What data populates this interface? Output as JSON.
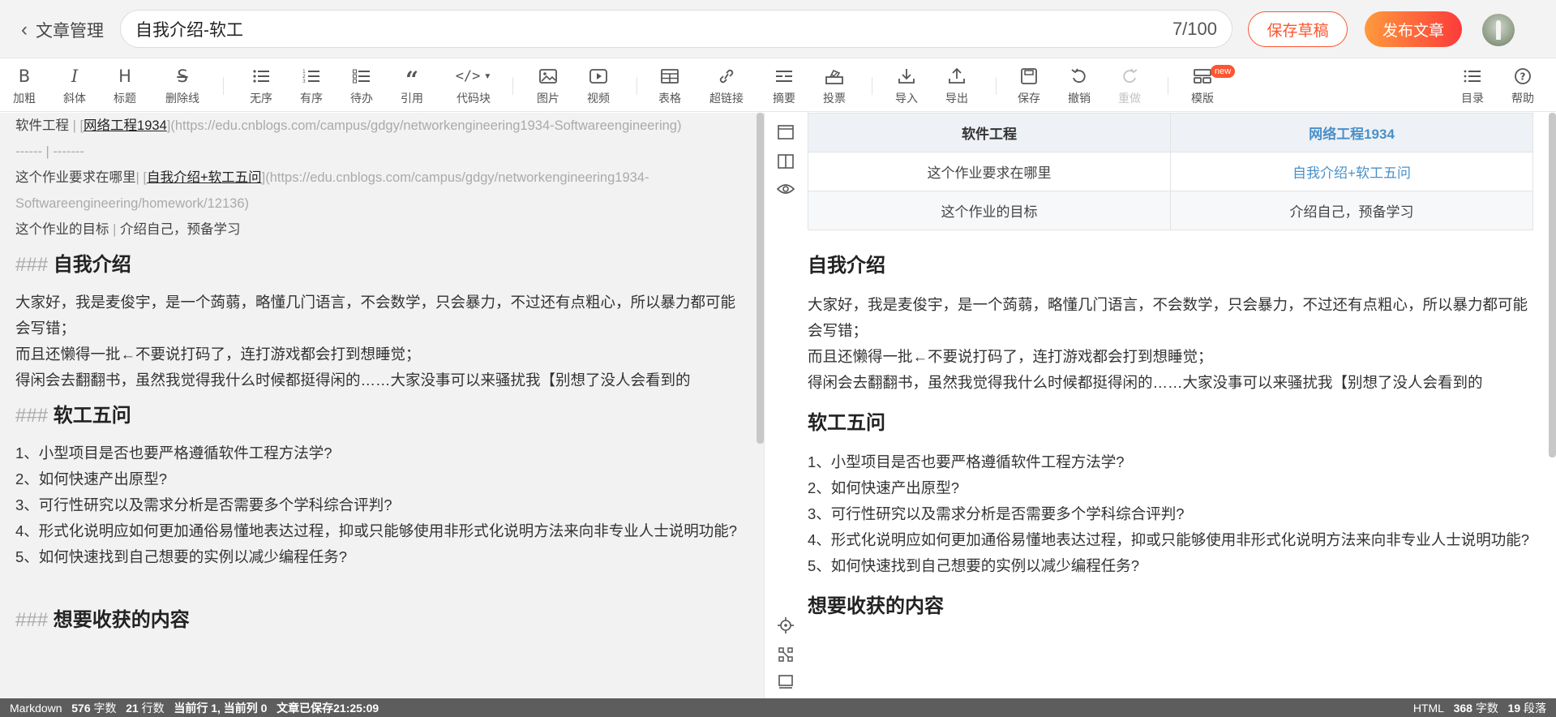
{
  "topbar": {
    "back_label": "文章管理",
    "title_value": "自我介绍-软工",
    "title_count": "7/100",
    "save_draft": "保存草稿",
    "publish": "发布文章"
  },
  "toolbar": {
    "bold": "加粗",
    "italic": "斜体",
    "heading": "标题",
    "strike": "删除线",
    "ul": "无序",
    "ol": "有序",
    "todo": "待办",
    "quote": "引用",
    "code": "代码块",
    "image": "图片",
    "video": "视频",
    "table": "表格",
    "link": "超链接",
    "summary": "摘要",
    "vote": "投票",
    "import": "导入",
    "export": "导出",
    "save": "保存",
    "undo": "撤销",
    "redo": "重做",
    "template": "模版",
    "template_badge": "new",
    "toc": "目录",
    "help": "帮助"
  },
  "editor": {
    "line1_course": "软件工程",
    "line1_sep": " | [",
    "line1_link": "网络工程1934",
    "line1_url": "](https://edu.cnblogs.com/campus/gdgy/networkengineering1934-Softwareengineering)",
    "line2": "------ | -------",
    "line3_label": "这个作业要求在哪里",
    "line3_sep": "| [",
    "line3_link": "自我介绍+软工五问",
    "line3_url_a": "](https://edu.cnblogs.com/campus/gdgy/networkengineering1934-",
    "line3_url_b": "Softwareengineering/homework/12136)",
    "line4_label": "这个作业的目标",
    "line4_sep": " | ",
    "line4_value": "介绍自己，预备学习",
    "h3_hash": "###",
    "h3_intro": "自我介绍",
    "intro_1": "大家好，我是麦俊宇，是一个蒟蒻，略懂几门语言，不会数学，只会暴力，不过还有点粗心，所以暴力都可能会写错；",
    "intro_2": "而且还懒得一批←不要说打码了，连打游戏都会打到想睡觉；",
    "intro_3": "得闲会去翻翻书，虽然我觉得我什么时候都挺得闲的……大家没事可以来骚扰我【别想了没人会看到的",
    "h3_five": "软工五问",
    "q1": "1、小型项目是否也要严格遵循软件工程方法学?",
    "q2": "2、如何快速产出原型?",
    "q3": "3、可行性研究以及需求分析是否需要多个学科综合评判?",
    "q4": "4、形式化说明应如何更加通俗易懂地表达过程，抑或只能够使用非形式化说明方法来向非专业人士说明功能?",
    "q5": "5、如何快速找到自己想要的实例以减少编程任务?",
    "h3_gain": "想要收获的内容"
  },
  "preview": {
    "table": {
      "h1": "软件工程",
      "h2": "网络工程1934",
      "r1c1": "这个作业要求在哪里",
      "r1c2": "自我介绍+软工五问",
      "r2c1": "这个作业的目标",
      "r2c2": "介绍自己，预备学习"
    }
  },
  "status": {
    "mode": "Markdown",
    "chars": "576",
    "chars_unit": "字数",
    "lines": "21",
    "lines_unit": "行数",
    "cursor": "当前行 1, 当前列 0",
    "saved": "文章已保存21:25:09",
    "right_mode": "HTML",
    "right_chars": "368",
    "right_chars_unit": "字数",
    "paras": "19",
    "paras_unit": "段落"
  }
}
